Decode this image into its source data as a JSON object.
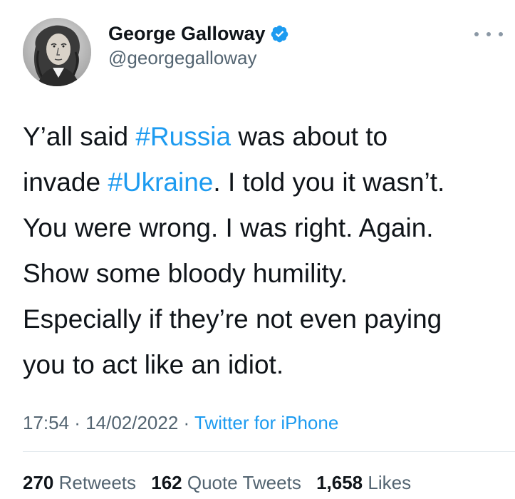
{
  "author": {
    "display_name": "George Galloway",
    "handle": "@georgegalloway",
    "verified": true,
    "avatar": "portrait-avatar"
  },
  "more_icon": "more-horizontal-icon",
  "tweet": {
    "lines": [
      [
        {
          "text": "Y’all said ",
          "type": "text"
        },
        {
          "text": "#Russia",
          "type": "hashtag"
        },
        {
          "text": " was about to",
          "type": "text"
        }
      ],
      [
        {
          "text": "invade ",
          "type": "text"
        },
        {
          "text": "#Ukraine",
          "type": "hashtag"
        },
        {
          "text": ". I told you it wasn’t.",
          "type": "text"
        }
      ],
      [
        {
          "text": "You were wrong. I was right. Again.",
          "type": "text"
        }
      ],
      [
        {
          "text": "Show some bloody humility.",
          "type": "text"
        }
      ],
      [
        {
          "text": "Especially if they’re not even paying",
          "type": "text"
        }
      ],
      [
        {
          "text": "you to act like an idiot.",
          "type": "text"
        }
      ]
    ]
  },
  "meta": {
    "time": "17:54",
    "separator": " · ",
    "date": "14/02/2022",
    "source": "Twitter for iPhone"
  },
  "stats": {
    "retweets_count": "270",
    "retweets_label": "Retweets",
    "quote_count": "162",
    "quote_label": "Quote Tweets",
    "likes_count": "1,658",
    "likes_label": "Likes"
  },
  "colors": {
    "link": "#1d9bf0",
    "secondary": "#536471",
    "primary": "#0f1419"
  }
}
